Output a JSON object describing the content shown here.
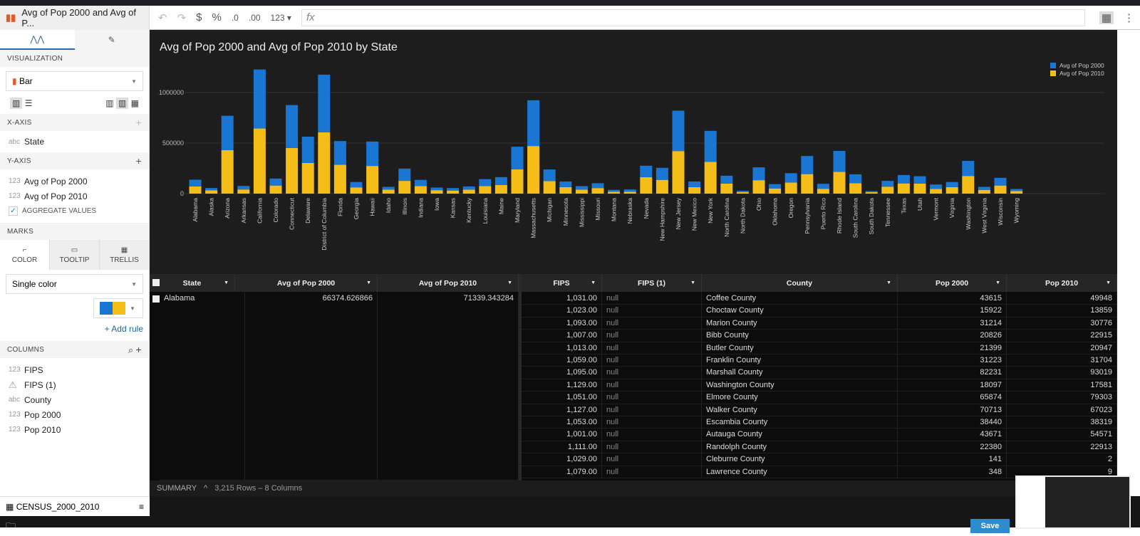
{
  "app": {
    "title": "Avg of Pop 2000 and Avg of P..."
  },
  "left_panel": {
    "tabs": [
      "chart-config",
      "format"
    ],
    "visualization_label": "VISUALIZATION",
    "chart_type": "Bar",
    "xaxis_label": "X-AXIS",
    "xaxis_field": {
      "type": "abc",
      "name": "State"
    },
    "yaxis_label": "Y-AXIS",
    "yaxis_fields": [
      {
        "type": "123",
        "name": "Avg of Pop 2000"
      },
      {
        "type": "123",
        "name": "Avg of Pop 2010"
      }
    ],
    "aggregate_label": "AGGREGATE VALUES",
    "aggregate_checked": true,
    "marks_label": "MARKS",
    "marks_tabs": [
      "COLOR",
      "TOOLTIP",
      "TRELLIS"
    ],
    "color_mode": "Single color",
    "add_rule": "+ Add rule",
    "columns_label": "COLUMNS",
    "columns": [
      {
        "type": "123",
        "name": "FIPS"
      },
      {
        "type": "warning",
        "name": "FIPS (1)"
      },
      {
        "type": "abc",
        "name": "County"
      },
      {
        "type": "123",
        "name": "Pop 2000"
      },
      {
        "type": "123",
        "name": "Pop 2010"
      }
    ],
    "dataset": "CENSUS_2000_2010"
  },
  "toolbar": {
    "currency": "$",
    "percent": "%",
    "dec_less": ".0",
    "dec_more": ".00",
    "format": "123"
  },
  "colors": {
    "pop2000": "#1976d2",
    "pop2010": "#f5bd17",
    "chart_bg": "#1d1d1d"
  },
  "chart_data": {
    "type": "bar",
    "stacked": true,
    "title": "Avg of Pop 2000 and Avg of Pop 2010 by State",
    "ylim": [
      0,
      1250000
    ],
    "yticks": [
      "0",
      "500000",
      "1000000"
    ],
    "grid": true,
    "legend": "top-right",
    "categories": [
      "Alabama",
      "Alaska",
      "Arizona",
      "Arkansas",
      "California",
      "Colorado",
      "Connecticut",
      "Delaware",
      "District of Columbia",
      "Florida",
      "Georgia",
      "Hawaii",
      "Idaho",
      "Illinois",
      "Indiana",
      "Iowa",
      "Kansas",
      "Kentucky",
      "Louisiana",
      "Maine",
      "Maryland",
      "Massachusetts",
      "Michigan",
      "Minnesota",
      "Mississippi",
      "Missouri",
      "Montana",
      "Nebraska",
      "Nevada",
      "New Hampshire",
      "New Jersey",
      "New Mexico",
      "New York",
      "North Carolina",
      "North Dakota",
      "Ohio",
      "Oklahoma",
      "Oregon",
      "Pennsylvania",
      "Puerto Rico",
      "Rhode Island",
      "South Carolina",
      "South Dakota",
      "Tennessee",
      "Texas",
      "Utah",
      "Vermont",
      "Virginia",
      "Washington",
      "West Virginia",
      "Wisconsin",
      "Wyoming"
    ],
    "series": [
      {
        "name": "Avg of Pop 2000",
        "values": [
          66375,
          23000,
          340000,
          35000,
          584000,
          69000,
          425000,
          260000,
          570000,
          235000,
          53000,
          241000,
          28000,
          122000,
          62000,
          26000,
          25000,
          32000,
          69000,
          78000,
          223000,
          453000,
          115000,
          56000,
          35000,
          48000,
          19000,
          23000,
          113000,
          119000,
          400000,
          56000,
          306000,
          78000,
          14000,
          127000,
          43000,
          92000,
          179000,
          49000,
          207000,
          88000,
          11000,
          57000,
          83000,
          73000,
          44000,
          51000,
          149000,
          30000,
          76000,
          21000
        ]
      },
      {
        "name": "Avg of Pop 2010",
        "values": [
          71339,
          32000,
          430000,
          41000,
          644000,
          80000,
          451000,
          303000,
          607000,
          285000,
          62000,
          274000,
          39000,
          126000,
          74000,
          34000,
          30000,
          39000,
          74000,
          85000,
          241000,
          471000,
          124000,
          64000,
          39000,
          55000,
          18000,
          18000,
          163000,
          136000,
          421000,
          64000,
          315000,
          99000,
          14000,
          133000,
          51000,
          110000,
          193000,
          48000,
          216000,
          103000,
          14000,
          69000,
          101000,
          99000,
          46000,
          64000,
          175000,
          37000,
          80000,
          25000
        ]
      }
    ]
  },
  "table": {
    "group_columns": [
      "State",
      "Avg of Pop 2000",
      "Avg of Pop 2010"
    ],
    "group_row": {
      "state": "Alabama",
      "avg2000": "66374.626866",
      "avg2010": "71339.343284"
    },
    "detail_columns": [
      "FIPS",
      "FIPS (1)",
      "County",
      "Pop 2000",
      "Pop 2010"
    ],
    "rows": [
      [
        "1,031.00",
        "null",
        "Coffee County",
        "43615",
        "49948"
      ],
      [
        "1,023.00",
        "null",
        "Choctaw County",
        "15922",
        "13859"
      ],
      [
        "1,093.00",
        "null",
        "Marion County",
        "31214",
        "30776"
      ],
      [
        "1,007.00",
        "null",
        "Bibb County",
        "20826",
        "22915"
      ],
      [
        "1,013.00",
        "null",
        "Butler County",
        "21399",
        "20947"
      ],
      [
        "1,059.00",
        "null",
        "Franklin County",
        "31223",
        "31704"
      ],
      [
        "1,095.00",
        "null",
        "Marshall County",
        "82231",
        "93019"
      ],
      [
        "1,129.00",
        "null",
        "Washington County",
        "18097",
        "17581"
      ],
      [
        "1,051.00",
        "null",
        "Elmore County",
        "65874",
        "79303"
      ],
      [
        "1,127.00",
        "null",
        "Walker County",
        "70713",
        "67023"
      ],
      [
        "1,053.00",
        "null",
        "Escambia County",
        "38440",
        "38319"
      ],
      [
        "1,001.00",
        "null",
        "Autauga County",
        "43671",
        "54571"
      ],
      [
        "1,111.00",
        "null",
        "Randolph County",
        "22380",
        "22913"
      ],
      [
        "1,029.00",
        "null",
        "Cleburne County",
        "141",
        "2"
      ],
      [
        "1,079.00",
        "null",
        "Lawrence County",
        "348",
        "9"
      ]
    ]
  },
  "summary": {
    "label": "SUMMARY",
    "info": "3,215 Rows – 8 Columns"
  },
  "footer": {
    "save": "Save"
  }
}
